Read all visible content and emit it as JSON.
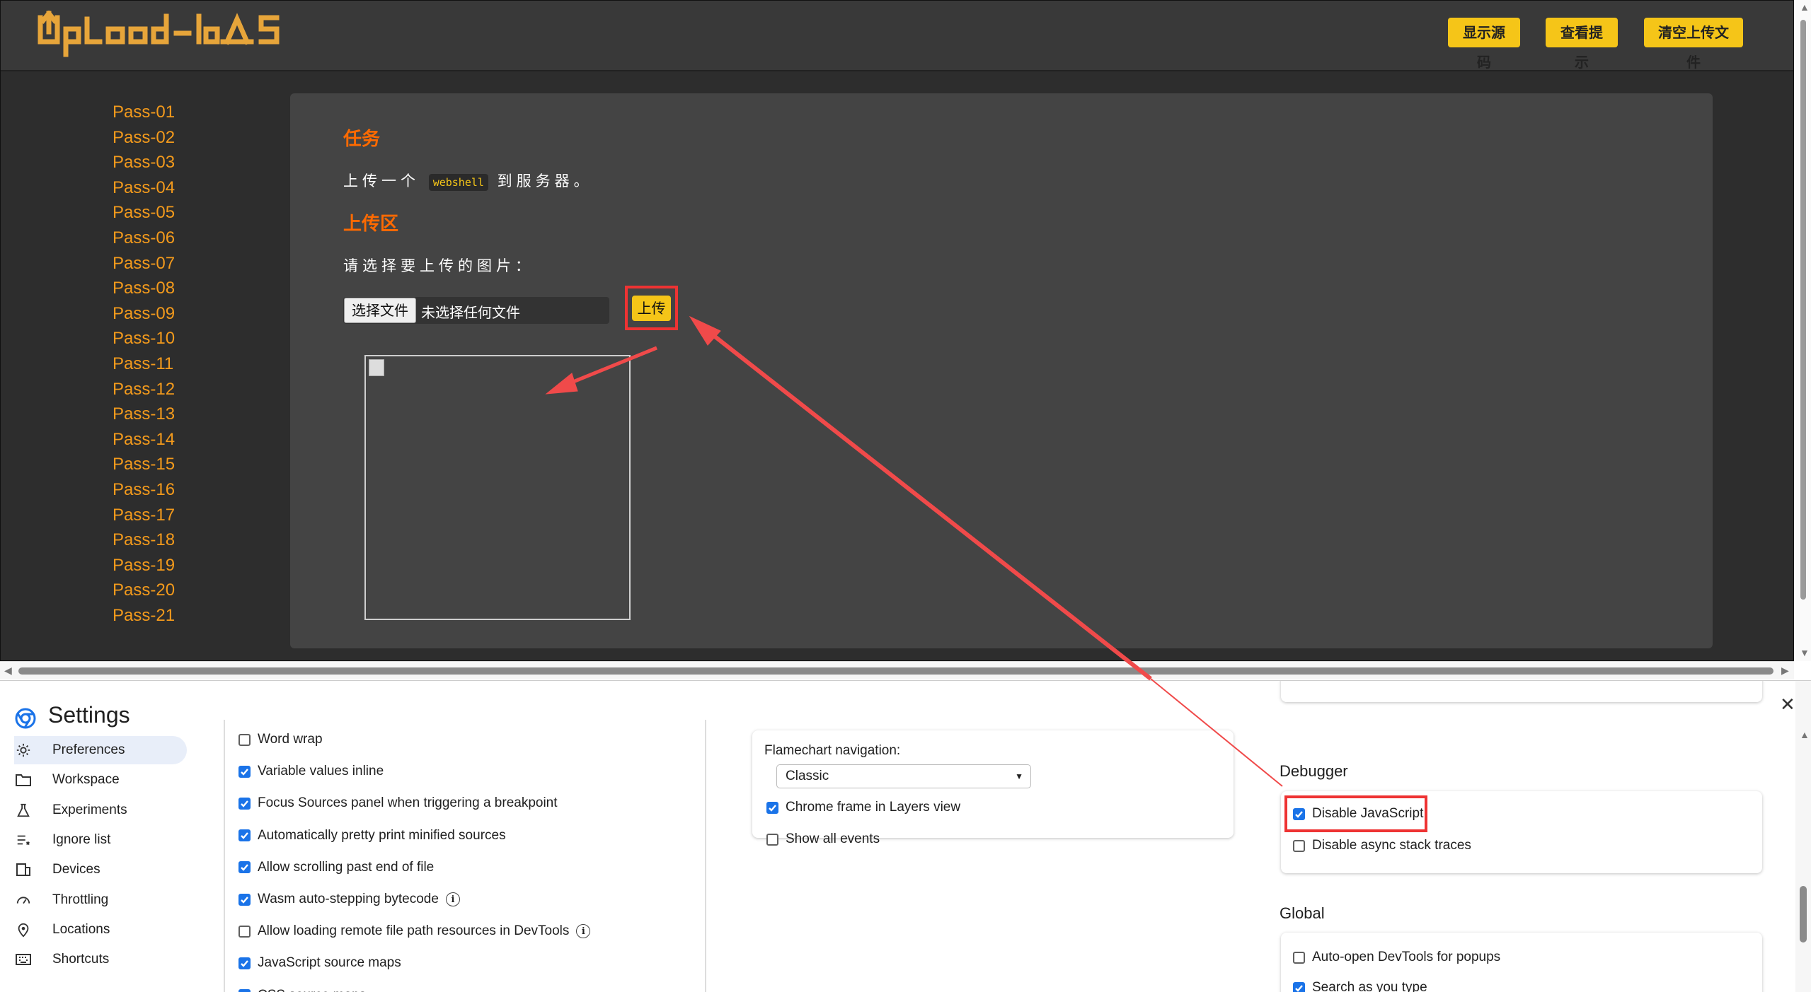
{
  "header": {
    "logo_text": "UpLoad-labS",
    "buttons": [
      "显示源码",
      "查看提示",
      "清空上传文件"
    ]
  },
  "sidebar": {
    "passes": [
      "Pass-01",
      "Pass-02",
      "Pass-03",
      "Pass-04",
      "Pass-05",
      "Pass-06",
      "Pass-07",
      "Pass-08",
      "Pass-09",
      "Pass-10",
      "Pass-11",
      "Pass-12",
      "Pass-13",
      "Pass-14",
      "Pass-15",
      "Pass-16",
      "Pass-17",
      "Pass-18",
      "Pass-19",
      "Pass-20",
      "Pass-21"
    ]
  },
  "main": {
    "task_title": "任务",
    "task_before": "上传一个",
    "task_code": "webshell",
    "task_after": "到服务器。",
    "upload_title": "上传区",
    "select_label": "请选择要上传的图片：",
    "file_button": "选择文件",
    "file_status": "未选择任何文件",
    "upload_button": "上传"
  },
  "devtools": {
    "title": "Settings",
    "nav": [
      {
        "label": "Preferences",
        "icon": "gear-icon",
        "active": true
      },
      {
        "label": "Workspace",
        "icon": "folder-icon",
        "active": false
      },
      {
        "label": "Experiments",
        "icon": "flask-icon",
        "active": false
      },
      {
        "label": "Ignore list",
        "icon": "list-icon",
        "active": false
      },
      {
        "label": "Devices",
        "icon": "devices-icon",
        "active": false
      },
      {
        "label": "Throttling",
        "icon": "gauge-icon",
        "active": false
      },
      {
        "label": "Locations",
        "icon": "pin-icon",
        "active": false
      },
      {
        "label": "Shortcuts",
        "icon": "keyboard-icon",
        "active": false
      }
    ],
    "sources_options": [
      {
        "label": "Word wrap",
        "checked": false,
        "info": false
      },
      {
        "label": "Variable values inline",
        "checked": true,
        "info": false
      },
      {
        "label": "Focus Sources panel when triggering a breakpoint",
        "checked": true,
        "info": false
      },
      {
        "label": "Automatically pretty print minified sources",
        "checked": true,
        "info": false
      },
      {
        "label": "Allow scrolling past end of file",
        "checked": true,
        "info": false
      },
      {
        "label": "Wasm auto-stepping bytecode",
        "checked": true,
        "info": true
      },
      {
        "label": "Allow loading remote file path resources in DevTools",
        "checked": false,
        "info": true
      },
      {
        "label": "JavaScript source maps",
        "checked": true,
        "info": false
      },
      {
        "label": "CSS source maps",
        "checked": true,
        "info": false
      }
    ],
    "performance": {
      "flamechart_label": "Flamechart navigation:",
      "flamechart_value": "Classic",
      "options": [
        {
          "label": "Chrome frame in Layers view",
          "checked": true
        },
        {
          "label": "Show all events",
          "checked": false
        }
      ]
    },
    "debugger": {
      "title": "Debugger",
      "options": [
        {
          "label": "Disable JavaScript",
          "checked": true
        },
        {
          "label": "Disable async stack traces",
          "checked": false
        }
      ]
    },
    "global": {
      "title": "Global",
      "options": [
        {
          "label": "Auto-open DevTools for popups",
          "checked": false
        },
        {
          "label": "Search as you type",
          "checked": true
        }
      ]
    }
  },
  "colors": {
    "accent_orange": "#ff6a00",
    "link_orange": "#f39a1c",
    "button_yellow": "#f5c518",
    "highlight_red": "#e33",
    "checkbox_blue": "#1a73e8"
  }
}
